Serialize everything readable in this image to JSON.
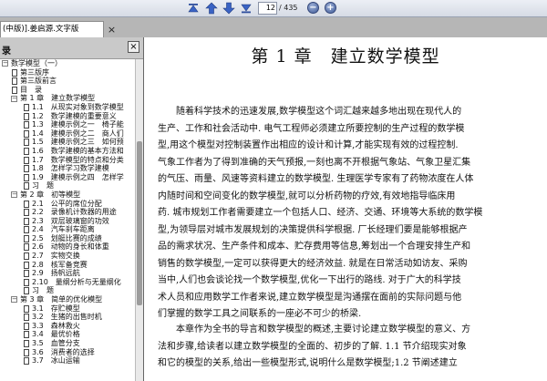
{
  "toolbar": {
    "page_current": "12",
    "page_total": "/ 435",
    "zoom_in": "+",
    "zoom_out": "−"
  },
  "tab": {
    "title": "(中版)].姜启源.文字版",
    "close": "×"
  },
  "sidebar": {
    "title": "录",
    "close": "×",
    "items": [
      {
        "label": "数学模型（一）",
        "level": 0,
        "expander": "minus"
      },
      {
        "label": "第三版序",
        "level": 1
      },
      {
        "label": "第三版前言",
        "level": 1
      },
      {
        "label": "目　录",
        "level": 1
      },
      {
        "label": "第 1 章　建立数学模型",
        "level": 1,
        "expander": "minus",
        "selected": true
      },
      {
        "label": "1.1　从现实对象到数学模型",
        "level": 2
      },
      {
        "label": "1.2　数学建模的重要意义",
        "level": 2
      },
      {
        "label": "1.3　建模示例之一　椅子能",
        "level": 2
      },
      {
        "label": "1.4　建模示例之二　商人们",
        "level": 2
      },
      {
        "label": "1.5　建模示例之三　如何预",
        "level": 2
      },
      {
        "label": "1.6　数学建模的基本方法和",
        "level": 2
      },
      {
        "label": "1.7　数学模型的特点和分类",
        "level": 2
      },
      {
        "label": "1.8　怎样学习数学建模",
        "level": 2
      },
      {
        "label": "1.9　建模示例之四　怎样学",
        "level": 2
      },
      {
        "label": "习　题",
        "level": 2
      },
      {
        "label": "第 2 章　初等模型",
        "level": 1,
        "expander": "minus"
      },
      {
        "label": "2.1　公平的席位分配",
        "level": 2
      },
      {
        "label": "2.2　录像机计数器的用途",
        "level": 2
      },
      {
        "label": "2.3　双层玻璃窗的功效",
        "level": 2
      },
      {
        "label": "2.4　汽车刹车距离",
        "level": 2
      },
      {
        "label": "2.5　划艇比赛的成绩",
        "level": 2
      },
      {
        "label": "2.6　动物的身长和体重",
        "level": 2
      },
      {
        "label": "2.7　实物交换",
        "level": 2
      },
      {
        "label": "2.8　核军备竞赛",
        "level": 2
      },
      {
        "label": "2.9　扬帆远航",
        "level": 2
      },
      {
        "label": "2.10　量纲分析与无量纲化",
        "level": 2
      },
      {
        "label": "习　题",
        "level": 2
      },
      {
        "label": "第 3 章　简单的优化模型",
        "level": 1,
        "expander": "minus"
      },
      {
        "label": "3.1　存贮模型",
        "level": 2
      },
      {
        "label": "3.2　生猪的出售时机",
        "level": 2
      },
      {
        "label": "3.3　森林救火",
        "level": 2
      },
      {
        "label": "3.4　最优价格",
        "level": 2
      },
      {
        "label": "3.5　血管分支",
        "level": 2
      },
      {
        "label": "3.6　消费者的选择",
        "level": 2
      },
      {
        "label": "3.7　冰山运输",
        "level": 2
      }
    ]
  },
  "document": {
    "chapter_title": "第 1 章　建立数学模型",
    "paragraph1": [
      "随着科学技术的迅速发展,数学模型这个词汇越来越多地出现在现代人的",
      "生产、工作和社会活动中. 电气工程师必须建立所要控制的生产过程的数学模",
      "型,用这个模型对控制装置作出相应的设计和计算,才能实现有效的过程控制.",
      "气象工作者为了得到准确的天气预报,一刻也离不开根据气象站、气象卫星汇集",
      "的气压、雨量、风速等资料建立的数学模型. 生理医学专家有了药物浓度在人体",
      "内随时间和空间变化的数学模型,就可以分析药物的疗效,有效地指导临床用",
      "药. 城市规划工作者需要建立一个包括人口、经济、交通、环境等大系统的数学模",
      "型,为领导层对城市发展规划的决策提供科学根据. 厂长经理们要是能够根据产",
      "品的需求状况、生产条件和成本、贮存费用等信息,筹划出一个合理安排生产和",
      "销售的数学模型,一定可以获得更大的经济效益. 就是在日常活动如访友、采购",
      "当中,人们也会谈论找一个数学模型,优化一下出行的路线. 对于广大的科学技",
      "术人员和应用数学工作者来说,建立数学模型是沟通摆在面前的实际问题与他",
      "们掌握的数学工具之间联系的一座必不可少的桥梁."
    ],
    "paragraph2": [
      "本章作为全书的导言和数学模型的概述,主要讨论建立数学模型的意义、方",
      "法和步骤,给读者以建立数学模型的全面的、初步的了解. 1.1 节介绍现实对象",
      "和它的模型的关系,给出一些模型形式,说明什么是数学模型;1.2 节阐述建立"
    ]
  }
}
